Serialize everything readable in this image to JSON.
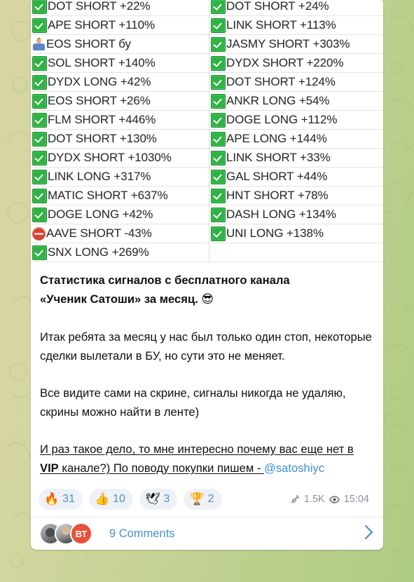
{
  "app": "telegram",
  "background": {
    "wallpaper_color_left": "#d7d5a4",
    "wallpaper_color_right": "#aecb83"
  },
  "message": {
    "signal_table": {
      "rows": [
        {
          "left": {
            "mark": "check-mark-green",
            "text": "DOT SHORT +22%"
          },
          "right": {
            "mark": "check-mark-green",
            "text": "DOT SHORT +24%"
          }
        },
        {
          "left": {
            "mark": "check-mark-green",
            "text": "APE SHORT +110%"
          },
          "right": {
            "mark": "check-mark-green",
            "text": "LINK SHORT +113%"
          }
        },
        {
          "left": {
            "mark": "person-emoji",
            "text": "EOS SHORT бу"
          },
          "right": {
            "mark": "check-mark-green",
            "text": "JASMY SHORT +303%"
          }
        },
        {
          "left": {
            "mark": "check-mark-green",
            "text": "SOL SHORT +140%"
          },
          "right": {
            "mark": "check-mark-green",
            "text": "DYDX SHORT +220%"
          }
        },
        {
          "left": {
            "mark": "check-mark-green",
            "text": "DYDX LONG +42%"
          },
          "right": {
            "mark": "check-mark-green",
            "text": "DOT SHORT +124%"
          }
        },
        {
          "left": {
            "mark": "check-mark-green",
            "text": "EOS SHORT +26%"
          },
          "right": {
            "mark": "check-mark-green",
            "text": "ANKR LONG +54%"
          }
        },
        {
          "left": {
            "mark": "check-mark-green",
            "text": "FLM SHORT +446%"
          },
          "right": {
            "mark": "check-mark-green",
            "text": "DOGE LONG +112%"
          }
        },
        {
          "left": {
            "mark": "check-mark-green",
            "text": "DOT SHORT +130%"
          },
          "right": {
            "mark": "check-mark-green",
            "text": "APE LONG +144%"
          }
        },
        {
          "left": {
            "mark": "check-mark-green",
            "text": "DYDX SHORT +1030%"
          },
          "right": {
            "mark": "check-mark-green",
            "text": "LINK SHORT +33%"
          }
        },
        {
          "left": {
            "mark": "check-mark-green",
            "text": "LINK LONG +317%"
          },
          "right": {
            "mark": "check-mark-green",
            "text": "GAL SHORT +44%"
          }
        },
        {
          "left": {
            "mark": "check-mark-green",
            "text": "MATIC SHORT +637%"
          },
          "right": {
            "mark": "check-mark-green",
            "text": "HNT SHORT +78%"
          }
        },
        {
          "left": {
            "mark": "check-mark-green",
            "text": "DOGE LONG +42%"
          },
          "right": {
            "mark": "check-mark-green",
            "text": "DASH LONG +134%"
          }
        },
        {
          "left": {
            "mark": "stop-sign-red",
            "text": "AAVE SHORT -43%"
          },
          "right": {
            "mark": "check-mark-green",
            "text": "UNI LONG +138%"
          }
        },
        {
          "left": {
            "mark": "check-mark-green",
            "text": "SNX LONG +269%"
          },
          "right": {
            "mark": "none",
            "text": ""
          }
        }
      ]
    },
    "paragraphs": {
      "p1_line1": "Статистика сигналов с бесплатного канала",
      "p1_line2": "«Ученик Сатоши» за месяц.",
      "p1_emoji": "😎",
      "p2": "Итак ребята за месяц у нас был только один стоп, некоторые сделки вылетали в БУ, но сути это не меняет.",
      "p3": "Все видите сами на скрине, сигналы никогда не удаляю, скрины можно найти в ленте)",
      "p4_part1": "И раз такое дело, то мне интересно почему вас еще нет в ",
      "p4_vip": "VIP",
      "p4_part2": " канале?) По поводу покупки пишем - ",
      "p4_mention": "@satoshiyc"
    },
    "reactions": [
      {
        "emoji": "🔥",
        "name": "fire-reaction",
        "count": "31"
      },
      {
        "emoji": "👍",
        "name": "thumbsup-reaction",
        "count": "10"
      },
      {
        "emoji": "🕊",
        "name": "dove-reaction",
        "count": "3"
      },
      {
        "emoji": "🏆",
        "name": "trophy-reaction",
        "count": "2"
      }
    ],
    "meta": {
      "views": "1.5K",
      "time": "15:04"
    },
    "comments": {
      "label": "9 Comments",
      "avatar_initials": "ВТ"
    }
  }
}
